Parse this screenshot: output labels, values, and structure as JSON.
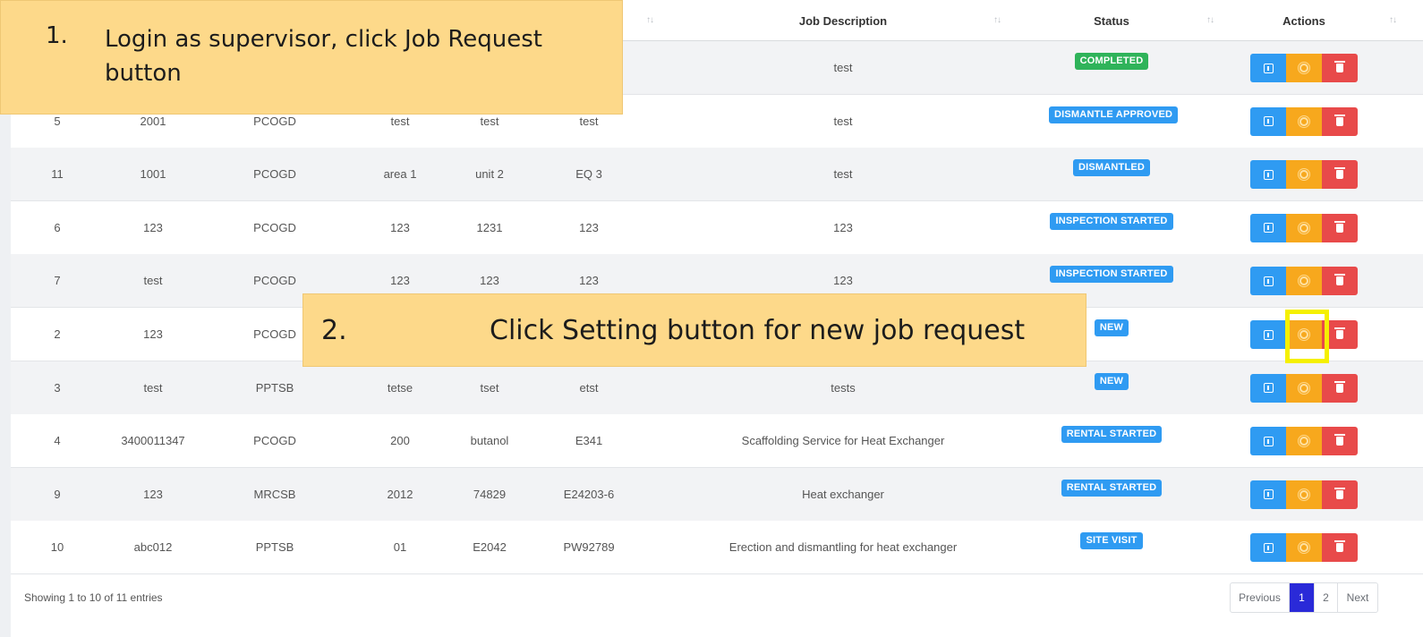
{
  "table": {
    "headers": {
      "job_description": "Job Description",
      "status": "Status",
      "actions": "Actions"
    },
    "sort_glyph": "↑↓",
    "rows": [
      {
        "c1": "",
        "c2": "",
        "c3": "",
        "c4": "",
        "c5": "",
        "c6": "",
        "description": "test",
        "status": "COMPLETED",
        "status_color": "#2fb35a"
      },
      {
        "c1": "5",
        "c2": "2001",
        "c3": "PCOGD",
        "c4": "test",
        "c5": "test",
        "c6": "test",
        "description": "test",
        "status": "DISMANTLE APPROVED",
        "status_color": "#2f9bf2"
      },
      {
        "c1": "11",
        "c2": "1001",
        "c3": "PCOGD",
        "c4": "area 1",
        "c5": "unit 2",
        "c6": "EQ 3",
        "description": "test",
        "status": "DISMANTLED",
        "status_color": "#2f9bf2"
      },
      {
        "c1": "6",
        "c2": "123",
        "c3": "PCOGD",
        "c4": "123",
        "c5": "1231",
        "c6": "123",
        "description": "123",
        "status": "INSPECTION STARTED",
        "status_color": "#2f9bf2"
      },
      {
        "c1": "7",
        "c2": "test",
        "c3": "PCOGD",
        "c4": "123",
        "c5": "123",
        "c6": "123",
        "description": "123",
        "status": "INSPECTION STARTED",
        "status_color": "#2f9bf2"
      },
      {
        "c1": "2",
        "c2": "123",
        "c3": "PCOGD",
        "c4": "",
        "c5": "",
        "c6": "",
        "description": "",
        "status": "NEW",
        "status_color": "#2f9bf2"
      },
      {
        "c1": "3",
        "c2": "test",
        "c3": "PPTSB",
        "c4": "tetse",
        "c5": "tset",
        "c6": "etst",
        "description": "tests",
        "status": "NEW",
        "status_color": "#2f9bf2"
      },
      {
        "c1": "4",
        "c2": "3400011347",
        "c3": "PCOGD",
        "c4": "200",
        "c5": "butanol",
        "c6": "E341",
        "description": "Scaffolding Service for Heat Exchanger",
        "status": "RENTAL STARTED",
        "status_color": "#2f9bf2"
      },
      {
        "c1": "9",
        "c2": "123",
        "c3": "MRCSB",
        "c4": "2012",
        "c5": "74829",
        "c6": "E24203-6",
        "description": "Heat exchanger",
        "status": "RENTAL STARTED",
        "status_color": "#2f9bf2"
      },
      {
        "c1": "10",
        "c2": "abc012",
        "c3": "PPTSB",
        "c4": "01",
        "c5": "E2042",
        "c6": "PW92789",
        "description": "Erection and dismantling for heat exchanger",
        "status": "SITE VISIT",
        "status_color": "#2f9bf2"
      }
    ]
  },
  "footer": {
    "info": "Showing 1 to 10 of 11 entries",
    "pagination": {
      "previous": "Previous",
      "pages": [
        "1",
        "2"
      ],
      "active_page": "1",
      "next": "Next"
    }
  },
  "annotations": {
    "step1_number": "1.",
    "step1_text": "Login as supervisor, click Job Request button",
    "step2_number": "2.",
    "step2_text": "Click Setting button for new job request"
  },
  "colors": {
    "view_button": "#2f9bf2",
    "setting_button": "#f7a81d",
    "delete_button": "#e84a4a",
    "callout": "#fdd98a",
    "highlight": "#f5f000",
    "pagination_active": "#2a2ad8"
  }
}
